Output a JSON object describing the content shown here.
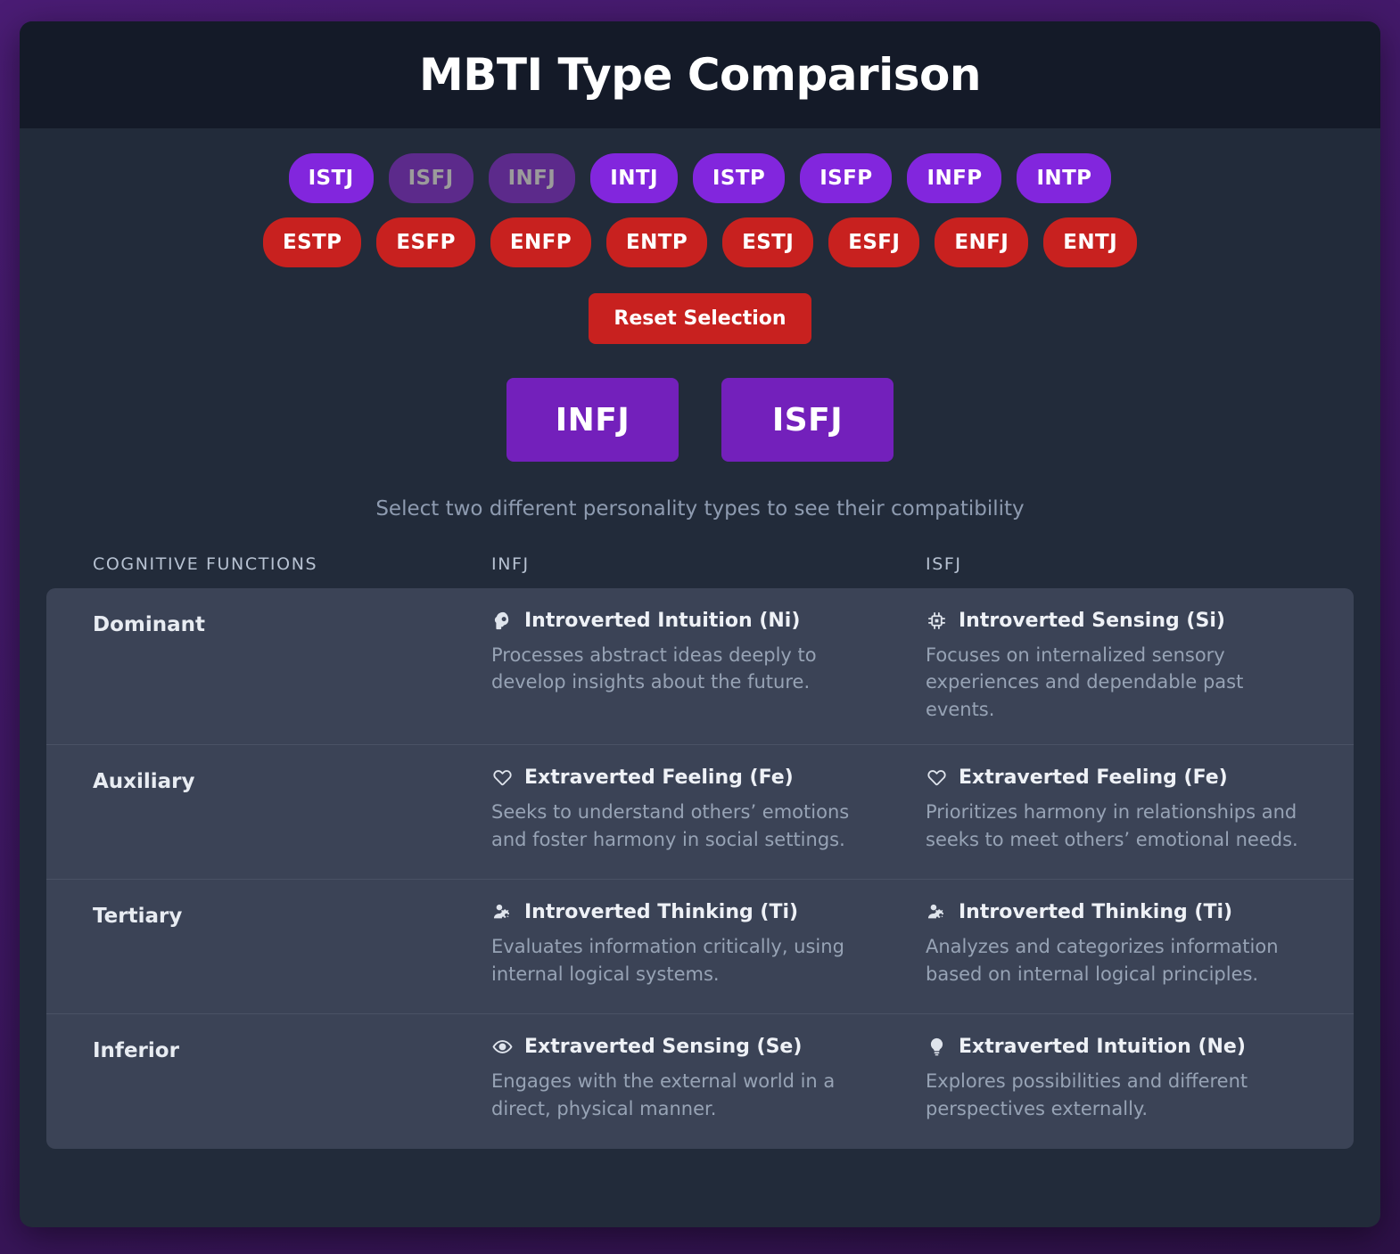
{
  "header": {
    "title": "MBTI Type Comparison"
  },
  "type_selector": {
    "introvert_types": [
      {
        "label": "ISTJ",
        "state": "default"
      },
      {
        "label": "ISFJ",
        "state": "selected"
      },
      {
        "label": "INFJ",
        "state": "selected"
      },
      {
        "label": "INTJ",
        "state": "default"
      },
      {
        "label": "ISTP",
        "state": "default"
      },
      {
        "label": "ISFP",
        "state": "default"
      },
      {
        "label": "INFP",
        "state": "default"
      },
      {
        "label": "INTP",
        "state": "default"
      }
    ],
    "extravert_types": [
      {
        "label": "ESTP",
        "state": "default"
      },
      {
        "label": "ESFP",
        "state": "default"
      },
      {
        "label": "ENFP",
        "state": "default"
      },
      {
        "label": "ENTP",
        "state": "default"
      },
      {
        "label": "ESTJ",
        "state": "default"
      },
      {
        "label": "ESFJ",
        "state": "default"
      },
      {
        "label": "ENFJ",
        "state": "default"
      },
      {
        "label": "ENTJ",
        "state": "default"
      }
    ],
    "reset_label": "Reset Selection",
    "colors": {
      "introvert": "#8226dd",
      "introvert_selected": "#5c2a8b",
      "extravert": "#c8211f",
      "selected_card": "#7320bb",
      "page_background": "#441a6b",
      "card_background": "#222b3a",
      "header_background": "#141a28",
      "table_background": "#3b4356"
    }
  },
  "selection": {
    "type_a": "INFJ",
    "type_b": "ISFJ",
    "hint": "Select two different personality types to see their compatibility"
  },
  "comparison": {
    "columns": {
      "functions": "COGNITIVE FUNCTIONS",
      "type_a": "INFJ",
      "type_b": "ISFJ"
    },
    "rows": [
      {
        "position": "Dominant",
        "a": {
          "icon": "brain-cog-icon",
          "name": "Introverted Intuition (Ni)",
          "description": "Processes abstract ideas deeply to develop insights about the future."
        },
        "b": {
          "icon": "cpu-chip-icon",
          "name": "Introverted Sensing (Si)",
          "description": "Focuses on internalized sensory experiences and dependable past events."
        }
      },
      {
        "position": "Auxiliary",
        "a": {
          "icon": "heart-icon",
          "name": "Extraverted Feeling (Fe)",
          "description": "Seeks to understand others’ emotions and foster harmony in social settings."
        },
        "b": {
          "icon": "heart-icon",
          "name": "Extraverted Feeling (Fe)",
          "description": "Prioritizes harmony in relationships and seeks to meet others’ emotional needs."
        }
      },
      {
        "position": "Tertiary",
        "a": {
          "icon": "user-cog-icon",
          "name": "Introverted Thinking (Ti)",
          "description": "Evaluates information critically, using internal logical systems."
        },
        "b": {
          "icon": "user-cog-icon",
          "name": "Introverted Thinking (Ti)",
          "description": "Analyzes and categorizes information based on internal logical principles."
        }
      },
      {
        "position": "Inferior",
        "a": {
          "icon": "eye-icon",
          "name": "Extraverted Sensing (Se)",
          "description": "Engages with the external world in a direct, physical manner."
        },
        "b": {
          "icon": "lightbulb-icon",
          "name": "Extraverted Intuition (Ne)",
          "description": "Explores possibilities and different perspectives externally."
        }
      }
    ]
  }
}
